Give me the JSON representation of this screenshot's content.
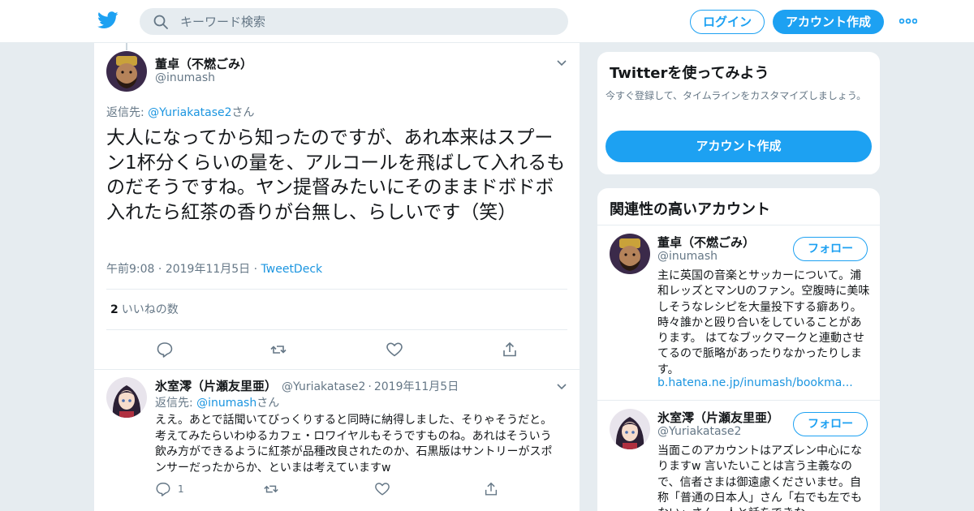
{
  "header": {
    "search_placeholder": "キーワード検索",
    "login_label": "ログイン",
    "signup_label": "アカウント作成"
  },
  "tweet": {
    "name": "董卓（不燃ごみ）",
    "handle": "@inumash",
    "reply_prefix": "返信先: ",
    "reply_to": "@Yuriakatase2",
    "reply_suffix": "さん",
    "text": "大人になってから知ったのですが、あれ本来はスプーン1杯分くらいの量を、アルコールを飛ばして入れるものだそうですね。ヤン提督みたいにそのままドボドボ入れたら紅茶の香りが台無し、らしいです（笑）",
    "time": "午前9:08",
    "date": "2019年11月5日",
    "source": "TweetDeck",
    "like_count": "2",
    "like_label": "いいねの数"
  },
  "reply": {
    "name": "氷室澪（片瀬友里亜）",
    "handle": "@Yuriakatase2",
    "date": "2019年11月5日",
    "reply_prefix": "返信先: ",
    "reply_to": "@inumash",
    "reply_suffix": "さん",
    "text": "ええ。あとで話聞いてびっくりすると同時に納得しました、そりゃそうだと。考えてみたらいわゆるカフェ・ロワイヤルもそうですものね。あれはそういう飲み方ができるように紅茶が品種改良されたのか、石黒版はサントリーがスポンサーだったからか、といまは考えていますw",
    "reply_count": "1"
  },
  "sidebar": {
    "signup_card": {
      "title": "Twitterを使ってみよう",
      "description": "今すぐ登録して、タイムラインをカスタマイズしましょう。",
      "button": "アカウント作成"
    },
    "related": {
      "title": "関連性の高いアカウント",
      "follow_label": "フォロー",
      "accounts": [
        {
          "name": "董卓（不燃ごみ）",
          "handle": "@inumash",
          "bio": "主に英国の音楽とサッカーについて。浦和レッズとマンUのファン。空腹時に美味しそうなレシピを大量投下する癖あり。 時々誰かと殴り合いをしていることがあります。 はてなブックマークと連動させてるので脈略があったりなかったりします。",
          "url": "b.hatena.ne.jp/inumash/bookma..."
        },
        {
          "name": "氷室澪（片瀬友里亜）",
          "handle": "@Yuriakatase2",
          "bio": "当面このアカウントはアズレン中心になりますw 言いたいことは言う主義なので、信者さまは御遠慮くださいませ。自称「普通の日本人」さん「右でも左でもない」さん、人と話をできな"
        }
      ]
    }
  },
  "colors": {
    "accent": "#1da1f2",
    "link": "#1b95e0",
    "muted": "#657786",
    "background": "#e6ecf0"
  },
  "icons": [
    "twitter-bird-icon",
    "search-icon",
    "more-dots-icon",
    "chevron-down-icon",
    "reply-icon",
    "retweet-icon",
    "like-icon",
    "share-icon"
  ]
}
